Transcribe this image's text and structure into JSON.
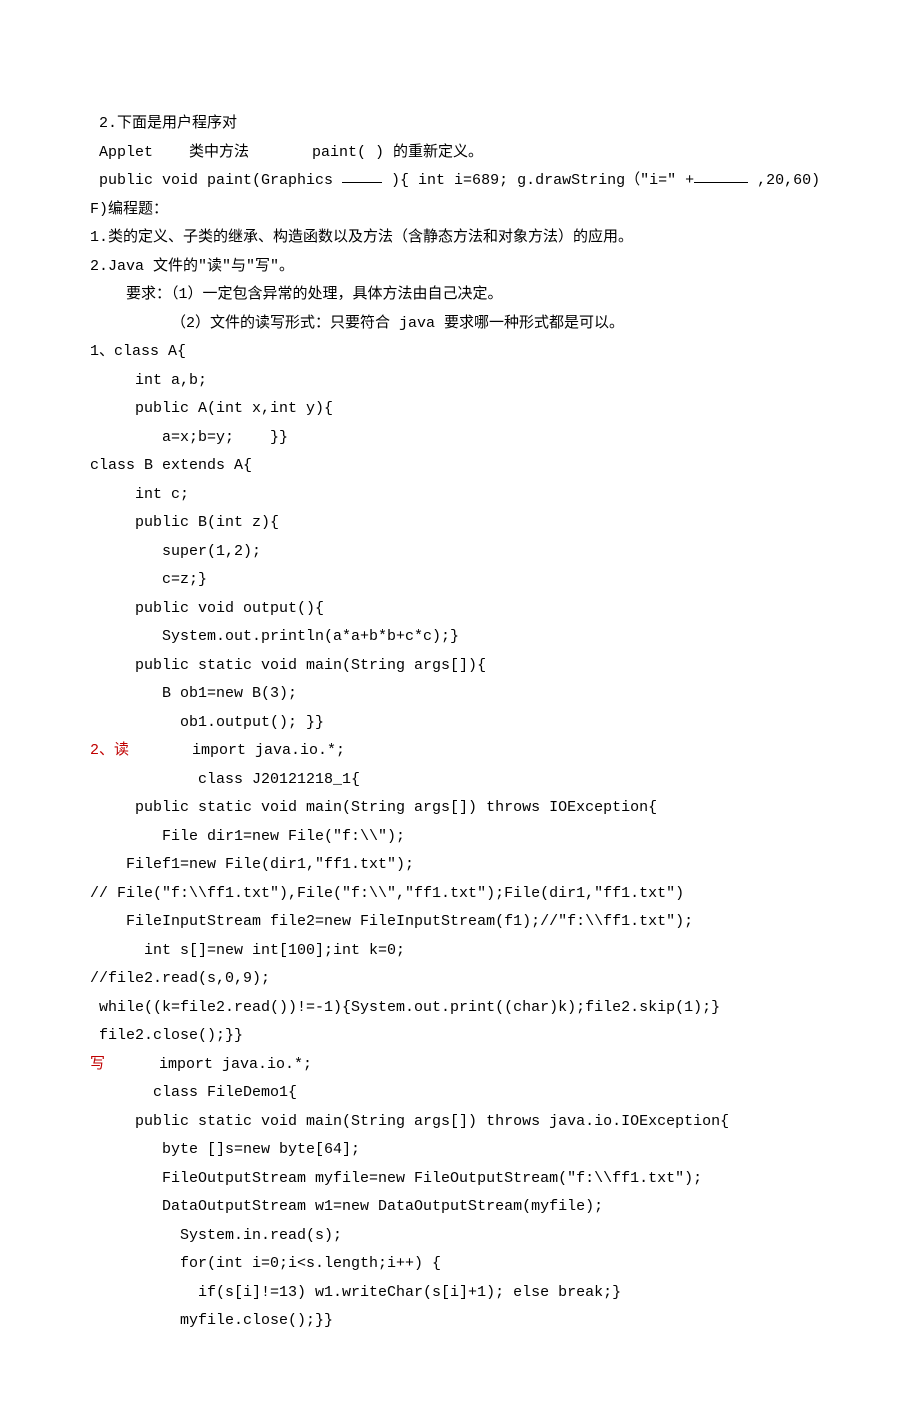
{
  "lines": [
    {
      "text": " 2.下面是用户程序对"
    },
    {
      "text": " Applet    类中方法       paint( ) 的重新定义。"
    },
    {
      "segments": [
        {
          "t": " public void paint(Graphics "
        },
        {
          "t": "    ",
          "u": true
        },
        {
          "t": " ){ int i=689; g.drawString（\"i=\" +"
        },
        {
          "t": "      ",
          "u": true
        },
        {
          "t": " ,20,60)"
        }
      ]
    },
    {
      "text": "F)编程题："
    },
    {
      "text": "1.类的定义、子类的继承、构造函数以及方法（含静态方法和对象方法）的应用。"
    },
    {
      "text": "2.Java 文件的\"读\"与\"写\"。"
    },
    {
      "text": "    要求：（1）一定包含异常的处理，具体方法由自己决定。"
    },
    {
      "text": "         （2）文件的读写形式：只要符合 java 要求哪一种形式都是可以。"
    },
    {
      "text": "1、class A{"
    },
    {
      "text": "     int a,b;"
    },
    {
      "text": "     public A(int x,int y){"
    },
    {
      "text": "        a=x;b=y;    }}"
    },
    {
      "text": "class B extends A{"
    },
    {
      "text": "     int c;"
    },
    {
      "text": "     public B(int z){"
    },
    {
      "text": "        super(1,2);"
    },
    {
      "text": "        c=z;}"
    },
    {
      "text": "     public void output(){"
    },
    {
      "text": "        System.out.println(a*a+b*b+c*c);}"
    },
    {
      "text": "     public static void main(String args[]){"
    },
    {
      "text": "        B ob1=new B(3);"
    },
    {
      "text": "          ob1.output(); }}"
    },
    {
      "segments": [
        {
          "t": "2、读",
          "red": true
        },
        {
          "t": "       import java.io.*;"
        }
      ]
    },
    {
      "text": "            class J20121218_1{"
    },
    {
      "text": "     public static void main(String args[]) throws IOException{"
    },
    {
      "text": "        File dir1=new File(\"f:\\\\\");"
    },
    {
      "text": "    Filef1=new File(dir1,\"ff1.txt\");"
    },
    {
      "text": "// File(\"f:\\\\ff1.txt\"),File(\"f:\\\\\",\"ff1.txt\");File(dir1,\"ff1.txt\")"
    },
    {
      "text": "    FileInputStream file2=new FileInputStream(f1);//\"f:\\\\ff1.txt\");"
    },
    {
      "text": "      int s[]=new int[100];int k=0;"
    },
    {
      "text": "//file2.read(s,0,9);"
    },
    {
      "text": " while((k=file2.read())!=-1){System.out.print((char)k);file2.skip(1);}"
    },
    {
      "text": " file2.close();}}"
    },
    {
      "segments": [
        {
          "t": "写",
          "red": true
        },
        {
          "t": "      import java.io.*;"
        }
      ]
    },
    {
      "text": "       class FileDemo1{"
    },
    {
      "text": "     public static void main(String args[]) throws java.io.IOException{"
    },
    {
      "text": "        byte []s=new byte[64];"
    },
    {
      "text": "        FileOutputStream myfile=new FileOutputStream(\"f:\\\\ff1.txt\");"
    },
    {
      "text": "        DataOutputStream w1=new DataOutputStream(myfile);"
    },
    {
      "text": "          System.in.read(s);"
    },
    {
      "text": "          for(int i=0;i<s.length;i++) {"
    },
    {
      "text": "            if(s[i]!=13) w1.writeChar(s[i]+1); else break;}"
    },
    {
      "text": "          myfile.close();}}"
    }
  ]
}
